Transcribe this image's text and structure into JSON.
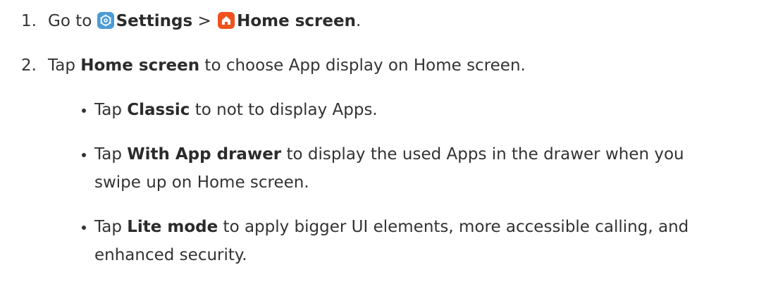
{
  "steps": [
    {
      "num": "1.",
      "prefix": "Go to ",
      "settings_label": "Settings",
      "separator": " > ",
      "home_label": "Home screen",
      "end": "."
    },
    {
      "num": "2.",
      "prefix": "Tap ",
      "bold": "Home screen",
      "rest": " to choose App display on Home screen."
    }
  ],
  "bullets": [
    {
      "prefix": "Tap ",
      "bold": "Classic",
      "rest_line1": " to not to display Apps.",
      "rest_line2": ""
    },
    {
      "prefix": "Tap ",
      "bold": "With App drawer",
      "rest_line1": " to display the used Apps in the drawer when you",
      "rest_line2": "swipe up on Home screen."
    },
    {
      "prefix": "Tap ",
      "bold": "Lite mode",
      "rest_line1": " to apply bigger UI elements, more accessible calling, and",
      "rest_line2": "enhanced security."
    }
  ],
  "icons": {
    "settings": "settings-gear-icon",
    "home": "home-icon",
    "settings_color": "#4a9bd6",
    "home_color": "#f0521f"
  }
}
